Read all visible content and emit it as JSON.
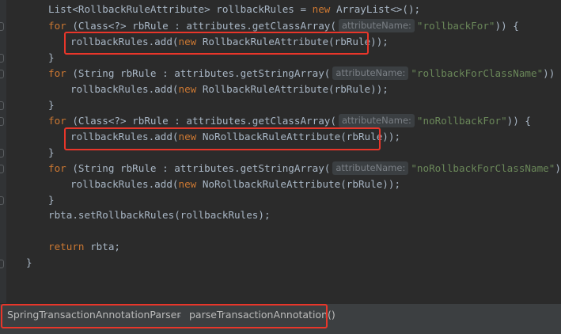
{
  "code": {
    "l1": {
      "p1": "List<RollbackRuleAttribute> rollbackRules = ",
      "kw": "new",
      "p2": " ArrayList<>();"
    },
    "l2": {
      "kw": "for",
      "p1": " (Class<?> rbRule : attributes.getClassArray(",
      "hint": "attributeName:",
      "str": "\"rollbackFor\"",
      "p2": ")) {"
    },
    "l3": {
      "p1": "rollbackRules.add(",
      "kw": "new",
      "p2": " RollbackRuleAttribute(rbRule));"
    },
    "l4": "}",
    "l5": {
      "kw": "for",
      "p1": " (String rbRule : attributes.getStringArray(",
      "hint": "attributeName:",
      "str": "\"rollbackForClassName\"",
      "p2": ")) {"
    },
    "l6": {
      "p1": "rollbackRules.add(",
      "kw": "new",
      "p2": " RollbackRuleAttribute(rbRule));"
    },
    "l7": "}",
    "l8": {
      "kw": "for",
      "p1": " (Class<?> rbRule : attributes.getClassArray(",
      "hint": "attributeName:",
      "str": "\"noRollbackFor\"",
      "p2": ")) {"
    },
    "l9": {
      "p1": "rollbackRules.add(",
      "kw": "new",
      "p2": " NoRollbackRuleAttribute(rbRule));"
    },
    "l10": "}",
    "l11": {
      "kw": "for",
      "p1": " (String rbRule : attributes.getStringArray(",
      "hint": "attributeName:",
      "str": "\"noRollbackForClassName\"",
      "p2": ")) {"
    },
    "l12": {
      "p1": "rollbackRules.add(",
      "kw": "new",
      "p2": " NoRollbackRuleAttribute(rbRule));"
    },
    "l13": "}",
    "l14": "rbta.setRollbackRules(rollbackRules);",
    "l15": {
      "kw": "return",
      "p1": " rbta;"
    },
    "l16": "}"
  },
  "breadcrumb": {
    "class_name": "SpringTransactionAnnotationParser",
    "method_name": "parseTransactionAnnotation()"
  },
  "colors": {
    "background": "#2b2b2b",
    "keyword": "#cc7832",
    "string": "#6a8759",
    "text": "#a9b7c6",
    "highlight_box": "#e8362a"
  }
}
